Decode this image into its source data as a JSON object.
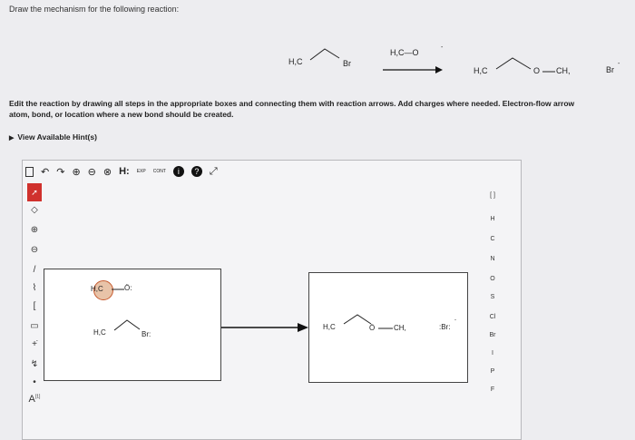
{
  "question": {
    "prompt": "Draw the mechanism for the following reaction:",
    "reactant_ch3": "H,C",
    "reactant_br": "Br",
    "reagent": "H,C—O",
    "reagent_charge": "-",
    "product_ch3": "H,C",
    "product_o": "O",
    "product_ch3_end": "CH,",
    "byproduct": "Br",
    "byproduct_charge": "-",
    "instructions_line1": "Edit the reaction by drawing all steps in the appropriate boxes and connecting them with reaction arrows. Add charges where needed. Electron-flow arrow",
    "instructions_line2": "atom, bond, or location where a new bond should be created.",
    "hint_label": "View Available Hint(s)"
  },
  "toolbar": {
    "h_label": "H:",
    "exp_label": "EXP",
    "cont_label": "CONT"
  },
  "side_tools": {
    "bracket_label": "[",
    "atom_label": "A",
    "atom_sup": "[1]"
  },
  "elements": {
    "header": "[ ]",
    "items": [
      "H",
      "C",
      "N",
      "O",
      "S",
      "Cl",
      "Br",
      "I",
      "P",
      "F"
    ]
  },
  "box1": {
    "methoxide_ch3": "H,C",
    "methoxide_o": "Ö:",
    "bromide_ch3": "H,C",
    "bromide_br": "Br:"
  },
  "box2": {
    "product_ch3": "H,C",
    "product_o": "Ö",
    "product_ch3_end": "CH,",
    "bromide_ion": ":Br:",
    "bromide_charge": "-"
  }
}
